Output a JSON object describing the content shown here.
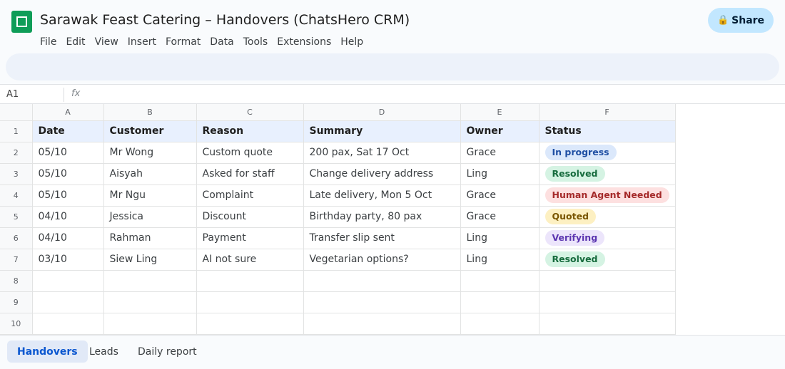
{
  "app": {
    "title": "Sarawak Feast Catering – Handovers (ChatsHero CRM)"
  },
  "menu": [
    "File",
    "Edit",
    "View",
    "Insert",
    "Format",
    "Data",
    "Tools",
    "Extensions",
    "Help"
  ],
  "share": {
    "label": "Share",
    "icon": "lock-icon"
  },
  "formula_bar": {
    "cell_ref": "A1",
    "fx": "fx",
    "value": ""
  },
  "columns": [
    "A",
    "B",
    "C",
    "D",
    "E",
    "F"
  ],
  "header": [
    "Date",
    "Customer",
    "Reason",
    "Summary",
    "Owner",
    "Status"
  ],
  "rows": [
    {
      "cells": [
        "05/10",
        "Mr Wong",
        "Custom quote",
        "200 pax, Sat 17 Oct",
        "Grace"
      ],
      "status": {
        "label": "In progress",
        "bg": "#dbe8fb",
        "fg": "#1f4fa3"
      }
    },
    {
      "cells": [
        "05/10",
        "Aisyah",
        "Asked for staff",
        "Change delivery address",
        "Ling"
      ],
      "status": {
        "label": "Resolved",
        "bg": "#d5f3e3",
        "fg": "#166b3d"
      }
    },
    {
      "cells": [
        "05/10",
        "Mr Ngu",
        "Complaint",
        "Late delivery, Mon 5 Oct",
        "Grace"
      ],
      "status": {
        "label": "Human Agent Needed",
        "bg": "#fde0e0",
        "fg": "#a52a2a"
      }
    },
    {
      "cells": [
        "04/10",
        "Jessica",
        "Discount",
        "Birthday party, 80 pax",
        "Grace"
      ],
      "status": {
        "label": "Quoted",
        "bg": "#fdf0c2",
        "fg": "#7a5600"
      }
    },
    {
      "cells": [
        "04/10",
        "Rahman",
        "Payment",
        "Transfer slip sent",
        "Ling"
      ],
      "status": {
        "label": "Verifying",
        "bg": "#ece5fb",
        "fg": "#5b35b0"
      }
    },
    {
      "cells": [
        "03/10",
        "Siew Ling",
        "AI not sure",
        "Vegetarian options?",
        "Ling"
      ],
      "status": {
        "label": "Resolved",
        "bg": "#d5f3e3",
        "fg": "#166b3d"
      }
    }
  ],
  "row_numbers": [
    "1",
    "2",
    "3",
    "4",
    "5",
    "6",
    "7",
    "8",
    "9",
    "10"
  ],
  "sheet_tabs": [
    {
      "label": "Handovers",
      "active": true
    },
    {
      "label": "Leads",
      "active": false
    },
    {
      "label": "Daily report",
      "active": false
    }
  ]
}
